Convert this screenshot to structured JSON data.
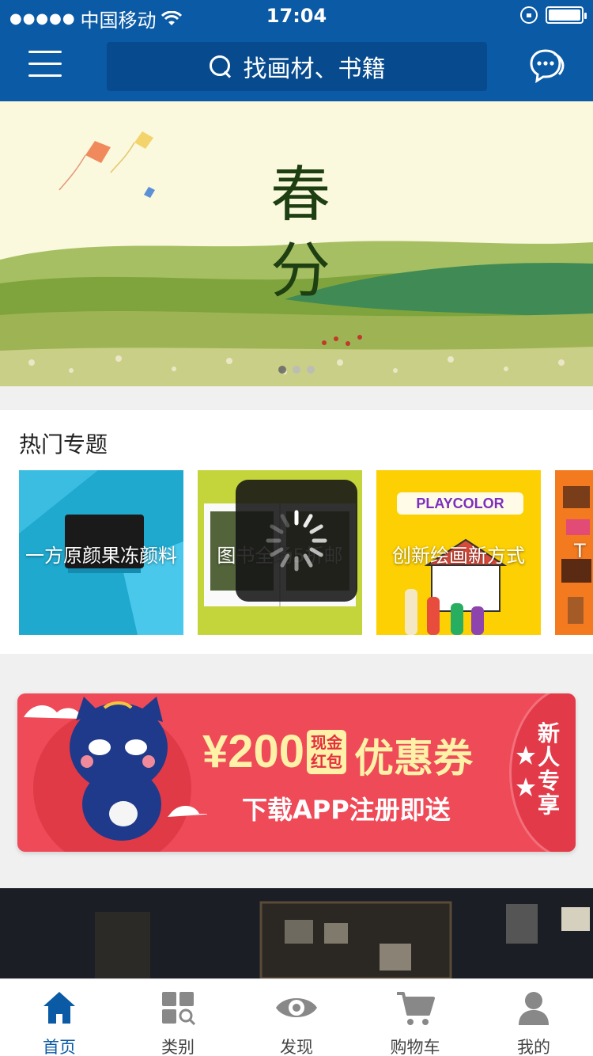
{
  "status_bar": {
    "signal_dots": "●●●●●",
    "carrier": "中国移动",
    "time": "17:04",
    "battery_level": 1.0
  },
  "header": {
    "search_placeholder": "找画材、书籍",
    "menu_icon": "hamburger-icon",
    "message_icon": "chat-icon"
  },
  "banner": {
    "title_line1": "春",
    "title_line2": "分",
    "slides": 3,
    "active_slide": 1
  },
  "hot_topics": {
    "title": "热门专题",
    "tiles": [
      {
        "label": "一方原颜果冻颜料",
        "color": "#1fa9cf"
      },
      {
        "label": "图书全场5折邮",
        "color": "#c4d53c"
      },
      {
        "label": "创新绘画新方式",
        "brand": "PLAYCOLOR",
        "color": "#fcd003"
      },
      {
        "label": "T",
        "color": "#f47a1f"
      }
    ]
  },
  "coupon": {
    "amount": "¥200",
    "tag_line1": "现金",
    "tag_line2": "红包",
    "word": "优惠券",
    "subtitle": "下载APP注册即送",
    "side_text": "新人专享",
    "color": "#ef4a58"
  },
  "tabbar": {
    "items": [
      {
        "label": "首页",
        "icon": "home-icon",
        "active": true
      },
      {
        "label": "类别",
        "icon": "category-icon",
        "active": false
      },
      {
        "label": "发现",
        "icon": "eye-icon",
        "active": false
      },
      {
        "label": "购物车",
        "icon": "cart-icon",
        "active": false
      },
      {
        "label": "我的",
        "icon": "user-icon",
        "active": false
      }
    ],
    "active_color": "#0a5aa5",
    "inactive_color": "#888888"
  }
}
